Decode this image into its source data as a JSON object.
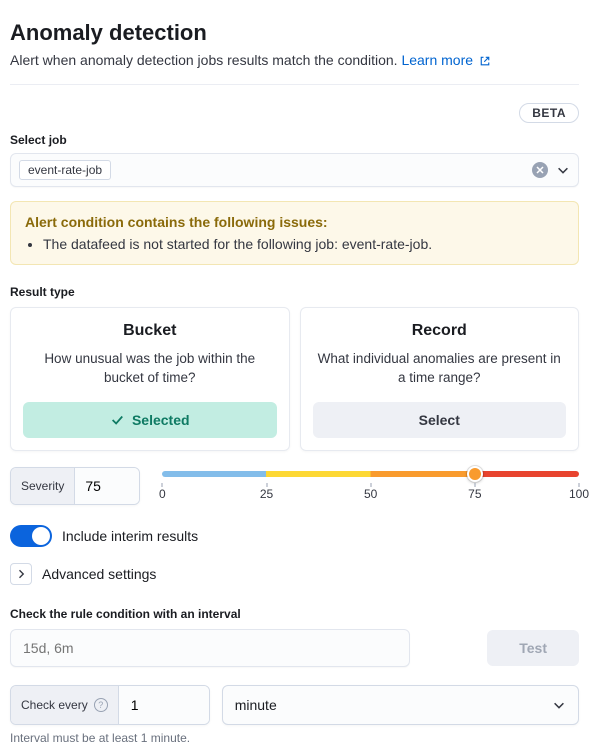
{
  "header": {
    "title": "Anomaly detection",
    "subtitle": "Alert when anomaly detection jobs results match the condition.",
    "learn_more": "Learn more"
  },
  "beta": "BETA",
  "select_job": {
    "label": "Select job",
    "selected": "event-rate-job"
  },
  "callout": {
    "title": "Alert condition contains the following issues:",
    "items": [
      "The datafeed is not started for the following job: event-rate-job."
    ]
  },
  "result_type": {
    "label": "Result type",
    "cards": [
      {
        "title": "Bucket",
        "desc": "How unusual was the job within the bucket of time?",
        "btn": "Selected",
        "selected": true
      },
      {
        "title": "Record",
        "desc": "What individual anomalies are present in a time range?",
        "btn": "Select",
        "selected": false
      }
    ]
  },
  "severity": {
    "label": "Severity",
    "value": "75",
    "ticks": [
      "0",
      "25",
      "50",
      "75",
      "100"
    ]
  },
  "interim_toggle": {
    "label": "Include interim results",
    "on": true
  },
  "advanced": {
    "label": "Advanced settings"
  },
  "interval": {
    "label": "Check the rule condition with an interval",
    "placeholder": "15d, 6m",
    "test_btn": "Test"
  },
  "check_every": {
    "label": "Check every",
    "value": "1",
    "unit": "minute",
    "help": "Interval must be at least 1 minute."
  }
}
